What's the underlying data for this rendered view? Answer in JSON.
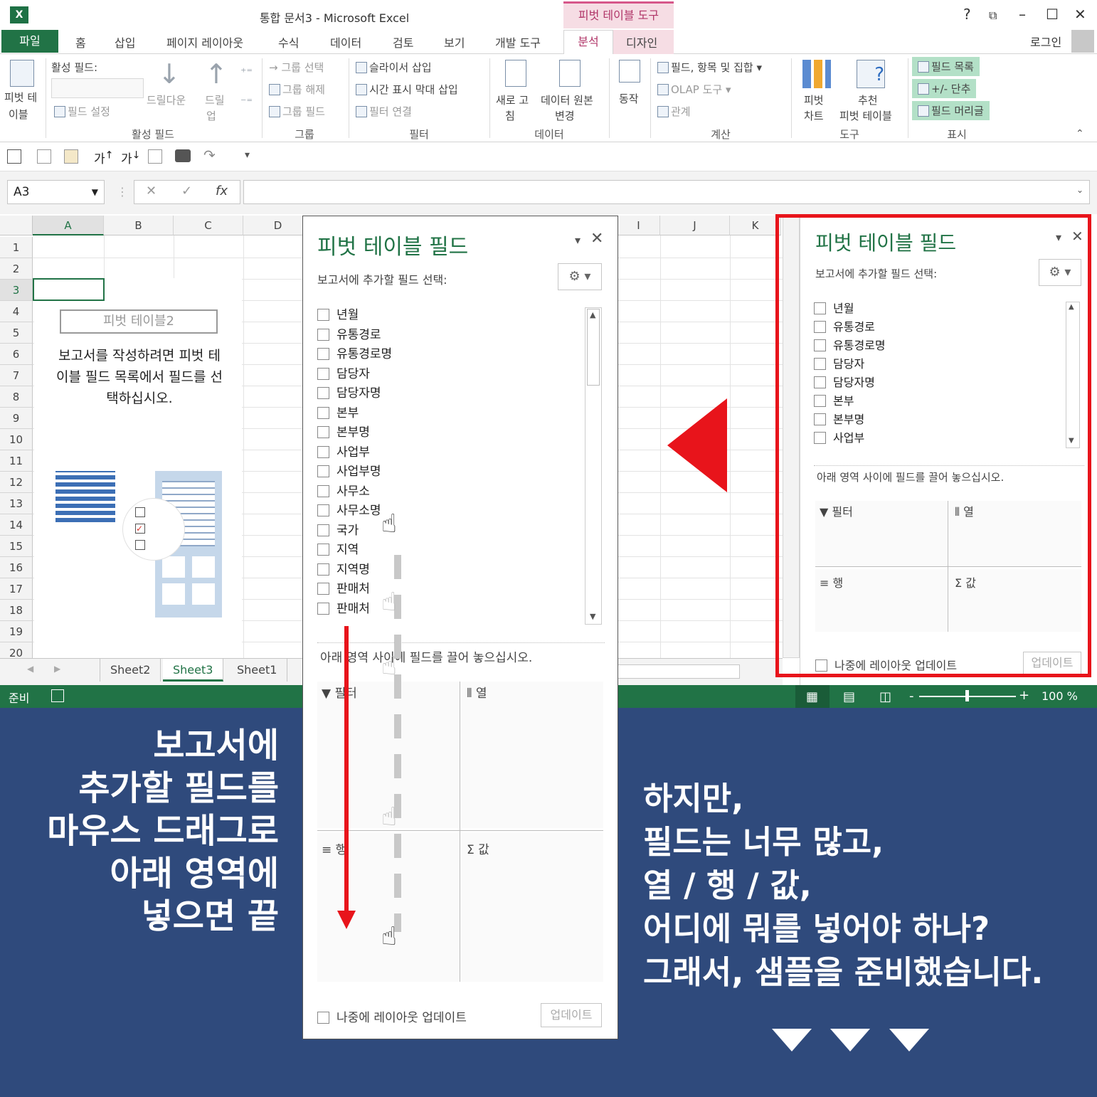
{
  "window": {
    "title": "통합 문서3 - Microsoft Excel",
    "context_tab_group": "피벗 테이블 도구",
    "help": "?",
    "login": "로그인"
  },
  "tabs": {
    "file": "파일",
    "items": [
      "홈",
      "삽입",
      "페이지 레이아웃",
      "수식",
      "데이터",
      "검토",
      "보기",
      "개발 도구"
    ],
    "analyze": "분석",
    "design": "디자인"
  },
  "ribbon": {
    "pivot_label_1": "피벗 테",
    "pivot_label_2": "이블",
    "active_field_label": "활성 필드:",
    "field_settings": "필드 설정",
    "drill_down": "드릴다운",
    "drill_up_1": "드릴",
    "drill_up_2": "업",
    "group_active_field": "활성 필드",
    "group_selection": "그룹 선택",
    "ungroup": "그룹 해제",
    "group_field": "그룹 필드",
    "group_group": "그룹",
    "insert_slicer": "슬라이서 삽입",
    "insert_timeline": "시간 표시 막대 삽입",
    "filter_connections": "필터 연결",
    "group_filter": "필터",
    "refresh_1": "새로 고",
    "refresh_2": "침",
    "change_source_1": "데이터 원본",
    "change_source_2": "변경",
    "group_data": "데이터",
    "actions": "동작",
    "fields_items_sets": "필드, 항목 및 집합",
    "olap_tools": "OLAP 도구",
    "relationships": "관계",
    "group_calculations": "계산",
    "pivot_chart_1": "피벗",
    "pivot_chart_2": "차트",
    "recommended_1": "추천",
    "recommended_2": "피벗 테이블",
    "group_tools": "도구",
    "field_list": "필드 목록",
    "buttons": "+/- 단추",
    "field_headers": "필드 머리글",
    "group_show": "표시"
  },
  "qat": {
    "font_up": "가",
    "font_down": "가"
  },
  "formula_bar": {
    "name_box": "A3",
    "fx": "fx",
    "value": ""
  },
  "sheet": {
    "columns": [
      "A",
      "B",
      "C",
      "D",
      "I",
      "J",
      "K"
    ],
    "rows": [
      "1",
      "2",
      "3",
      "4",
      "5",
      "6",
      "7",
      "8",
      "9",
      "10",
      "11",
      "12",
      "13",
      "14",
      "15",
      "16",
      "17",
      "18",
      "19",
      "20"
    ],
    "pivot_name": "피벗 테이블2",
    "pivot_msg_1": "보고서를 작성하려면 피벗 테",
    "pivot_msg_2": "이블 필드 목록에서 필드를 선",
    "pivot_msg_3": "택하십시오.",
    "tabs": [
      "Sheet2",
      "Sheet3",
      "Sheet1"
    ],
    "active_tab": "Sheet3"
  },
  "status": {
    "ready": "준비",
    "zoom": "100 %"
  },
  "panel_center": {
    "title": "피벗 테이블 필드",
    "subtitle": "보고서에 추가할 필드 선택:",
    "fields": [
      "년월",
      "유통경로",
      "유통경로명",
      "담당자",
      "담당자명",
      "본부",
      "본부명",
      "사업부",
      "사업부명",
      "사무소",
      "사무소명",
      "국가",
      "지역",
      "지역명",
      "판매처",
      "판매처"
    ],
    "drag_hint": "아래 영역 사이에 필드를 끌어 놓으십시오.",
    "area_filter": "필터",
    "area_columns": "열",
    "area_rows": "행",
    "area_values": "값",
    "defer_update": "나중에 레이아웃 업데이트",
    "update_btn": "업데이트"
  },
  "panel_right": {
    "title": "피벗 테이블 필드",
    "subtitle": "보고서에 추가할 필드 선택:",
    "fields": [
      "년월",
      "유통경로",
      "유통경로명",
      "담당자",
      "담당자명",
      "본부",
      "본부명",
      "사업부"
    ],
    "drag_hint": "아래 영역 사이에 필드를 끌어 놓으십시오.",
    "area_filter": "필터",
    "area_columns": "열",
    "area_rows": "행",
    "area_values": "값",
    "defer_update": "나중에 레이아웃 업데이트",
    "update_btn": "업데이트"
  },
  "caption_left": [
    "보고서에",
    "추가할 필드를",
    "마우스 드래그로",
    "아래 영역에",
    "넣으면 끝"
  ],
  "caption_right": [
    "하지만,",
    "필드는 너무 많고,",
    "열 / 행 / 값,",
    "어디에 뭐를 넣어야 하나?",
    "그래서, 샘플을 준비했습니다."
  ],
  "colors": {
    "excel_green": "#217346",
    "highlight_red": "#e8141b",
    "banner_blue": "#2f4a7c",
    "context_pink": "#f6dde4"
  }
}
